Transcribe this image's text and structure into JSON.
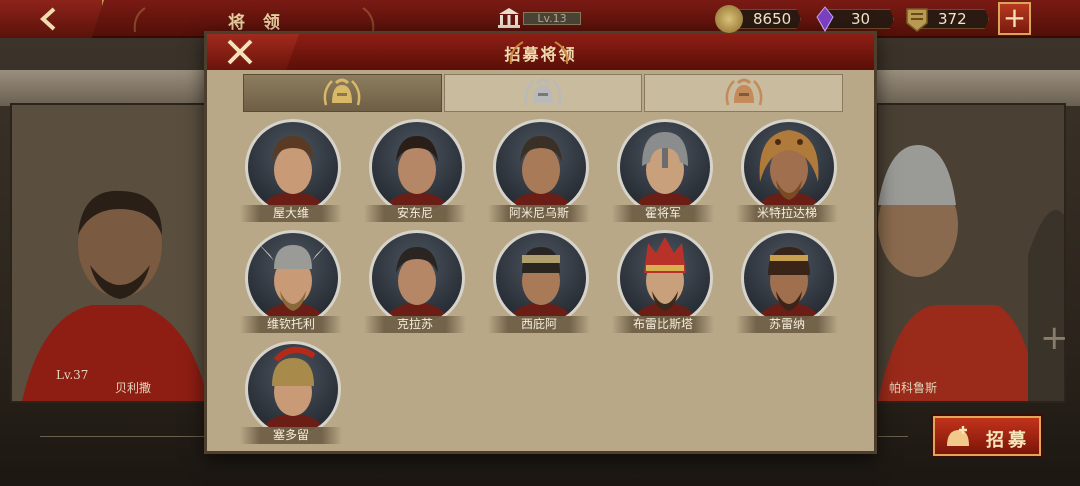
{
  "topbar": {
    "title": "将 领",
    "level": "Lv.13",
    "gold": "8650",
    "gems": "30",
    "tokens": "372",
    "back_icon": "chevron-left-icon",
    "plus_label": "+"
  },
  "background": {
    "left_general_name": "贝利撒",
    "left_general_level": "Lv.37",
    "right_general_name": "帕科鲁斯",
    "add_slot_label": "+",
    "recruit_button": "招募"
  },
  "modal": {
    "title": "招募将领",
    "tabs": [
      {
        "name": "gold-rank-tab",
        "icon": "gold-helmet-laurel-icon",
        "color": "#d9b867",
        "active": true
      },
      {
        "name": "silver-rank-tab",
        "icon": "silver-helmet-laurel-icon",
        "color": "#b9b9b9",
        "active": false
      },
      {
        "name": "bronze-rank-tab",
        "icon": "bronze-helmet-laurel-icon",
        "color": "#c58a5a",
        "active": false
      }
    ],
    "heroes": [
      {
        "name": "屋大维",
        "headgear": "none",
        "hair": "#5a3a22",
        "beard": false
      },
      {
        "name": "安东尼",
        "headgear": "none",
        "hair": "#2a1f18",
        "beard": false
      },
      {
        "name": "阿米尼乌斯",
        "headgear": "none",
        "hair": "#3a3026",
        "beard": false
      },
      {
        "name": "霍将军",
        "headgear": "helmet",
        "hair": "#555",
        "beard": false
      },
      {
        "name": "米特拉达梯",
        "headgear": "lion",
        "hair": "#7a4a22",
        "beard": true
      },
      {
        "name": "维钦托利",
        "headgear": "winged",
        "hair": "#8a6a3a",
        "beard": true
      },
      {
        "name": "克拉苏",
        "headgear": "none",
        "hair": "#2a2520",
        "beard": false
      },
      {
        "name": "西庇阿",
        "headgear": "band",
        "hair": "#2a2520",
        "beard": false
      },
      {
        "name": "布雷比斯塔",
        "headgear": "crown",
        "hair": "#3a2a1e",
        "beard": true
      },
      {
        "name": "苏雷纳",
        "headgear": "headband",
        "hair": "#3a2418",
        "beard": true
      },
      {
        "name": "塞多留",
        "headgear": "plumed",
        "hair": "#2a2018",
        "beard": false
      }
    ]
  }
}
